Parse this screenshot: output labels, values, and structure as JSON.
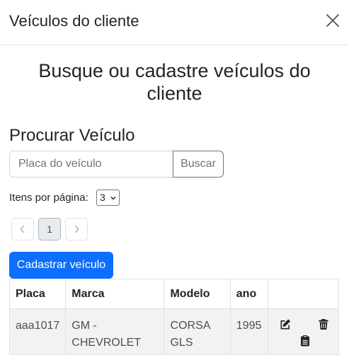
{
  "modal": {
    "title": "Veículos do cliente"
  },
  "heading": "Busque ou cadastre veículos do cliente",
  "search": {
    "section_title": "Procurar Veículo",
    "placeholder": "Placa do veículo",
    "value": "",
    "button_label": "Buscar"
  },
  "pagination": {
    "per_page_label": "Itens por página:",
    "per_page_value": "3",
    "current_page": "1",
    "prev_icon": "chevron-left-icon",
    "next_icon": "chevron-right-icon"
  },
  "add_button_label": "Cadastrar veículo",
  "table": {
    "headers": [
      "Placa",
      "Marca",
      "Modelo",
      "ano",
      ""
    ],
    "rows": [
      {
        "placa": "aaa1017",
        "marca": "GM - CHEVROLET",
        "modelo": "CORSA GLS",
        "ano": "1995",
        "actions": [
          "edit-icon",
          "trash-icon",
          "clipboard-icon"
        ]
      }
    ]
  },
  "colors": {
    "primary": "#0d6efd",
    "secondary": "#6c757d",
    "border": "#dee2e6",
    "row_bg": "#f2f2f2"
  }
}
